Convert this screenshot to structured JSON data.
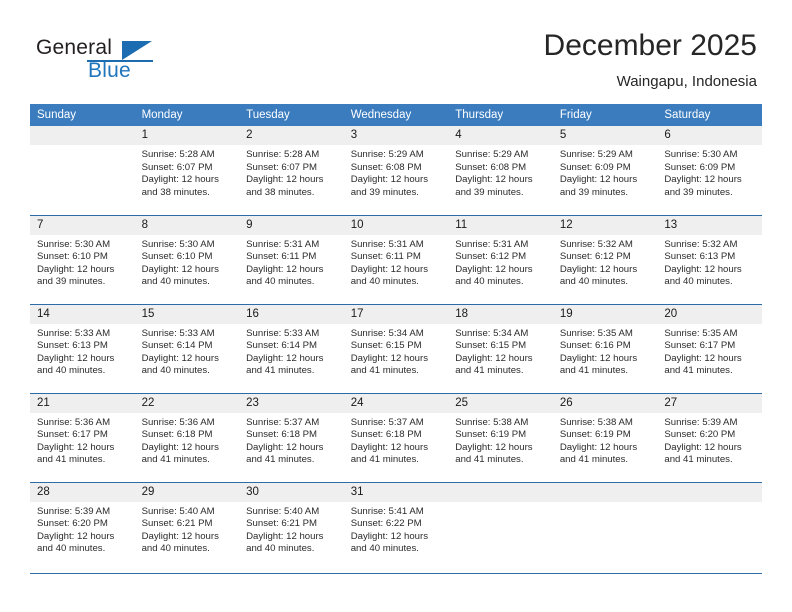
{
  "brand": {
    "name_top": "General",
    "name_bottom": "Blue",
    "triangle_icon": "triangle-icon",
    "colors": {
      "dark": "#231f20",
      "blue": "#1f76bc"
    }
  },
  "header": {
    "month_title": "December 2025",
    "location": "Waingapu, Indonesia"
  },
  "colors": {
    "header_row_bg": "#3b7cbf",
    "header_row_text": "#ffffff",
    "day_number_bg": "#efeff0",
    "grid_line": "#2c6ca8",
    "body_text": "#2b2b2b"
  },
  "calendar": {
    "weekdays": [
      "Sunday",
      "Monday",
      "Tuesday",
      "Wednesday",
      "Thursday",
      "Friday",
      "Saturday"
    ],
    "weeks": [
      [
        {
          "blank": true
        },
        {
          "day": "1",
          "sunrise": "Sunrise: 5:28 AM",
          "sunset": "Sunset: 6:07 PM",
          "daylight_1": "Daylight: 12 hours",
          "daylight_2": "and 38 minutes."
        },
        {
          "day": "2",
          "sunrise": "Sunrise: 5:28 AM",
          "sunset": "Sunset: 6:07 PM",
          "daylight_1": "Daylight: 12 hours",
          "daylight_2": "and 38 minutes."
        },
        {
          "day": "3",
          "sunrise": "Sunrise: 5:29 AM",
          "sunset": "Sunset: 6:08 PM",
          "daylight_1": "Daylight: 12 hours",
          "daylight_2": "and 39 minutes."
        },
        {
          "day": "4",
          "sunrise": "Sunrise: 5:29 AM",
          "sunset": "Sunset: 6:08 PM",
          "daylight_1": "Daylight: 12 hours",
          "daylight_2": "and 39 minutes."
        },
        {
          "day": "5",
          "sunrise": "Sunrise: 5:29 AM",
          "sunset": "Sunset: 6:09 PM",
          "daylight_1": "Daylight: 12 hours",
          "daylight_2": "and 39 minutes."
        },
        {
          "day": "6",
          "sunrise": "Sunrise: 5:30 AM",
          "sunset": "Sunset: 6:09 PM",
          "daylight_1": "Daylight: 12 hours",
          "daylight_2": "and 39 minutes."
        }
      ],
      [
        {
          "day": "7",
          "sunrise": "Sunrise: 5:30 AM",
          "sunset": "Sunset: 6:10 PM",
          "daylight_1": "Daylight: 12 hours",
          "daylight_2": "and 39 minutes."
        },
        {
          "day": "8",
          "sunrise": "Sunrise: 5:30 AM",
          "sunset": "Sunset: 6:10 PM",
          "daylight_1": "Daylight: 12 hours",
          "daylight_2": "and 40 minutes."
        },
        {
          "day": "9",
          "sunrise": "Sunrise: 5:31 AM",
          "sunset": "Sunset: 6:11 PM",
          "daylight_1": "Daylight: 12 hours",
          "daylight_2": "and 40 minutes."
        },
        {
          "day": "10",
          "sunrise": "Sunrise: 5:31 AM",
          "sunset": "Sunset: 6:11 PM",
          "daylight_1": "Daylight: 12 hours",
          "daylight_2": "and 40 minutes."
        },
        {
          "day": "11",
          "sunrise": "Sunrise: 5:31 AM",
          "sunset": "Sunset: 6:12 PM",
          "daylight_1": "Daylight: 12 hours",
          "daylight_2": "and 40 minutes."
        },
        {
          "day": "12",
          "sunrise": "Sunrise: 5:32 AM",
          "sunset": "Sunset: 6:12 PM",
          "daylight_1": "Daylight: 12 hours",
          "daylight_2": "and 40 minutes."
        },
        {
          "day": "13",
          "sunrise": "Sunrise: 5:32 AM",
          "sunset": "Sunset: 6:13 PM",
          "daylight_1": "Daylight: 12 hours",
          "daylight_2": "and 40 minutes."
        }
      ],
      [
        {
          "day": "14",
          "sunrise": "Sunrise: 5:33 AM",
          "sunset": "Sunset: 6:13 PM",
          "daylight_1": "Daylight: 12 hours",
          "daylight_2": "and 40 minutes."
        },
        {
          "day": "15",
          "sunrise": "Sunrise: 5:33 AM",
          "sunset": "Sunset: 6:14 PM",
          "daylight_1": "Daylight: 12 hours",
          "daylight_2": "and 40 minutes."
        },
        {
          "day": "16",
          "sunrise": "Sunrise: 5:33 AM",
          "sunset": "Sunset: 6:14 PM",
          "daylight_1": "Daylight: 12 hours",
          "daylight_2": "and 41 minutes."
        },
        {
          "day": "17",
          "sunrise": "Sunrise: 5:34 AM",
          "sunset": "Sunset: 6:15 PM",
          "daylight_1": "Daylight: 12 hours",
          "daylight_2": "and 41 minutes."
        },
        {
          "day": "18",
          "sunrise": "Sunrise: 5:34 AM",
          "sunset": "Sunset: 6:15 PM",
          "daylight_1": "Daylight: 12 hours",
          "daylight_2": "and 41 minutes."
        },
        {
          "day": "19",
          "sunrise": "Sunrise: 5:35 AM",
          "sunset": "Sunset: 6:16 PM",
          "daylight_1": "Daylight: 12 hours",
          "daylight_2": "and 41 minutes."
        },
        {
          "day": "20",
          "sunrise": "Sunrise: 5:35 AM",
          "sunset": "Sunset: 6:17 PM",
          "daylight_1": "Daylight: 12 hours",
          "daylight_2": "and 41 minutes."
        }
      ],
      [
        {
          "day": "21",
          "sunrise": "Sunrise: 5:36 AM",
          "sunset": "Sunset: 6:17 PM",
          "daylight_1": "Daylight: 12 hours",
          "daylight_2": "and 41 minutes."
        },
        {
          "day": "22",
          "sunrise": "Sunrise: 5:36 AM",
          "sunset": "Sunset: 6:18 PM",
          "daylight_1": "Daylight: 12 hours",
          "daylight_2": "and 41 minutes."
        },
        {
          "day": "23",
          "sunrise": "Sunrise: 5:37 AM",
          "sunset": "Sunset: 6:18 PM",
          "daylight_1": "Daylight: 12 hours",
          "daylight_2": "and 41 minutes."
        },
        {
          "day": "24",
          "sunrise": "Sunrise: 5:37 AM",
          "sunset": "Sunset: 6:18 PM",
          "daylight_1": "Daylight: 12 hours",
          "daylight_2": "and 41 minutes."
        },
        {
          "day": "25",
          "sunrise": "Sunrise: 5:38 AM",
          "sunset": "Sunset: 6:19 PM",
          "daylight_1": "Daylight: 12 hours",
          "daylight_2": "and 41 minutes."
        },
        {
          "day": "26",
          "sunrise": "Sunrise: 5:38 AM",
          "sunset": "Sunset: 6:19 PM",
          "daylight_1": "Daylight: 12 hours",
          "daylight_2": "and 41 minutes."
        },
        {
          "day": "27",
          "sunrise": "Sunrise: 5:39 AM",
          "sunset": "Sunset: 6:20 PM",
          "daylight_1": "Daylight: 12 hours",
          "daylight_2": "and 41 minutes."
        }
      ],
      [
        {
          "day": "28",
          "sunrise": "Sunrise: 5:39 AM",
          "sunset": "Sunset: 6:20 PM",
          "daylight_1": "Daylight: 12 hours",
          "daylight_2": "and 40 minutes."
        },
        {
          "day": "29",
          "sunrise": "Sunrise: 5:40 AM",
          "sunset": "Sunset: 6:21 PM",
          "daylight_1": "Daylight: 12 hours",
          "daylight_2": "and 40 minutes."
        },
        {
          "day": "30",
          "sunrise": "Sunrise: 5:40 AM",
          "sunset": "Sunset: 6:21 PM",
          "daylight_1": "Daylight: 12 hours",
          "daylight_2": "and 40 minutes."
        },
        {
          "day": "31",
          "sunrise": "Sunrise: 5:41 AM",
          "sunset": "Sunset: 6:22 PM",
          "daylight_1": "Daylight: 12 hours",
          "daylight_2": "and 40 minutes."
        },
        {
          "blank": true
        },
        {
          "blank": true
        },
        {
          "blank": true
        }
      ]
    ]
  }
}
